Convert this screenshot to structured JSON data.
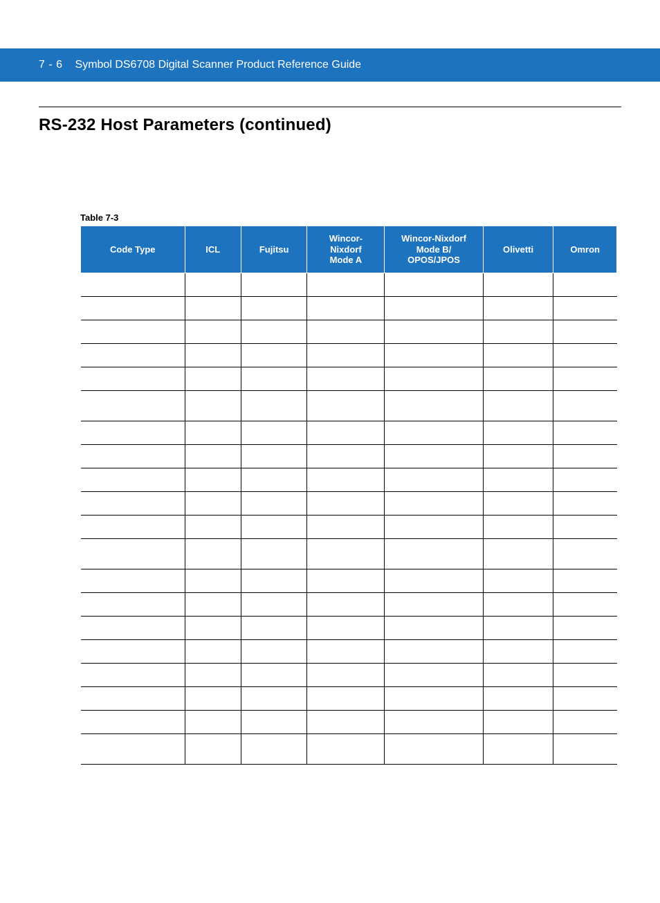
{
  "header": {
    "page_number": "7 - 6",
    "doc_title": "Symbol DS6708 Digital Scanner Product Reference Guide"
  },
  "section_title": "RS-232 Host Parameters (continued)",
  "table": {
    "caption": "Table 7-3",
    "columns": [
      "Code Type",
      "ICL",
      "Fujitsu",
      "Wincor-\nNixdorf\nMode A",
      "Wincor-Nixdorf\nMode B/\nOPOS/JPOS",
      "Olivetti",
      "Omron"
    ],
    "rows": [
      {
        "tall": false,
        "cells": [
          "",
          "",
          "",
          "",
          "",
          "",
          ""
        ]
      },
      {
        "tall": false,
        "cells": [
          "",
          "",
          "",
          "",
          "",
          "",
          ""
        ]
      },
      {
        "tall": false,
        "cells": [
          "",
          "",
          "",
          "",
          "",
          "",
          ""
        ]
      },
      {
        "tall": false,
        "cells": [
          "",
          "",
          "",
          "",
          "",
          "",
          ""
        ]
      },
      {
        "tall": false,
        "cells": [
          "",
          "",
          "",
          "",
          "",
          "",
          ""
        ]
      },
      {
        "tall": true,
        "cells": [
          "",
          "",
          "",
          "",
          "",
          "",
          ""
        ]
      },
      {
        "tall": false,
        "cells": [
          "",
          "",
          "",
          "",
          "",
          "",
          ""
        ]
      },
      {
        "tall": false,
        "cells": [
          "",
          "",
          "",
          "",
          "",
          "",
          ""
        ]
      },
      {
        "tall": false,
        "cells": [
          "",
          "",
          "",
          "",
          "",
          "",
          ""
        ]
      },
      {
        "tall": false,
        "cells": [
          "",
          "",
          "",
          "",
          "",
          "",
          ""
        ]
      },
      {
        "tall": false,
        "cells": [
          "",
          "",
          "",
          "",
          "",
          "",
          ""
        ]
      },
      {
        "tall": true,
        "cells": [
          "",
          "",
          "",
          "",
          "",
          "",
          ""
        ]
      },
      {
        "tall": false,
        "cells": [
          "",
          "",
          "",
          "",
          "",
          "",
          ""
        ]
      },
      {
        "tall": false,
        "cells": [
          "",
          "",
          "",
          "",
          "",
          "",
          ""
        ]
      },
      {
        "tall": false,
        "cells": [
          "",
          "",
          "",
          "",
          "",
          "",
          ""
        ]
      },
      {
        "tall": false,
        "cells": [
          "",
          "",
          "",
          "",
          "",
          "",
          ""
        ]
      },
      {
        "tall": false,
        "cells": [
          "",
          "",
          "",
          "",
          "",
          "",
          ""
        ]
      },
      {
        "tall": false,
        "cells": [
          "",
          "",
          "",
          "",
          "",
          "",
          ""
        ]
      },
      {
        "tall": false,
        "cells": [
          "",
          "",
          "",
          "",
          "",
          "",
          ""
        ]
      },
      {
        "tall": true,
        "cells": [
          "",
          "",
          "",
          "",
          "",
          "",
          ""
        ]
      }
    ]
  }
}
